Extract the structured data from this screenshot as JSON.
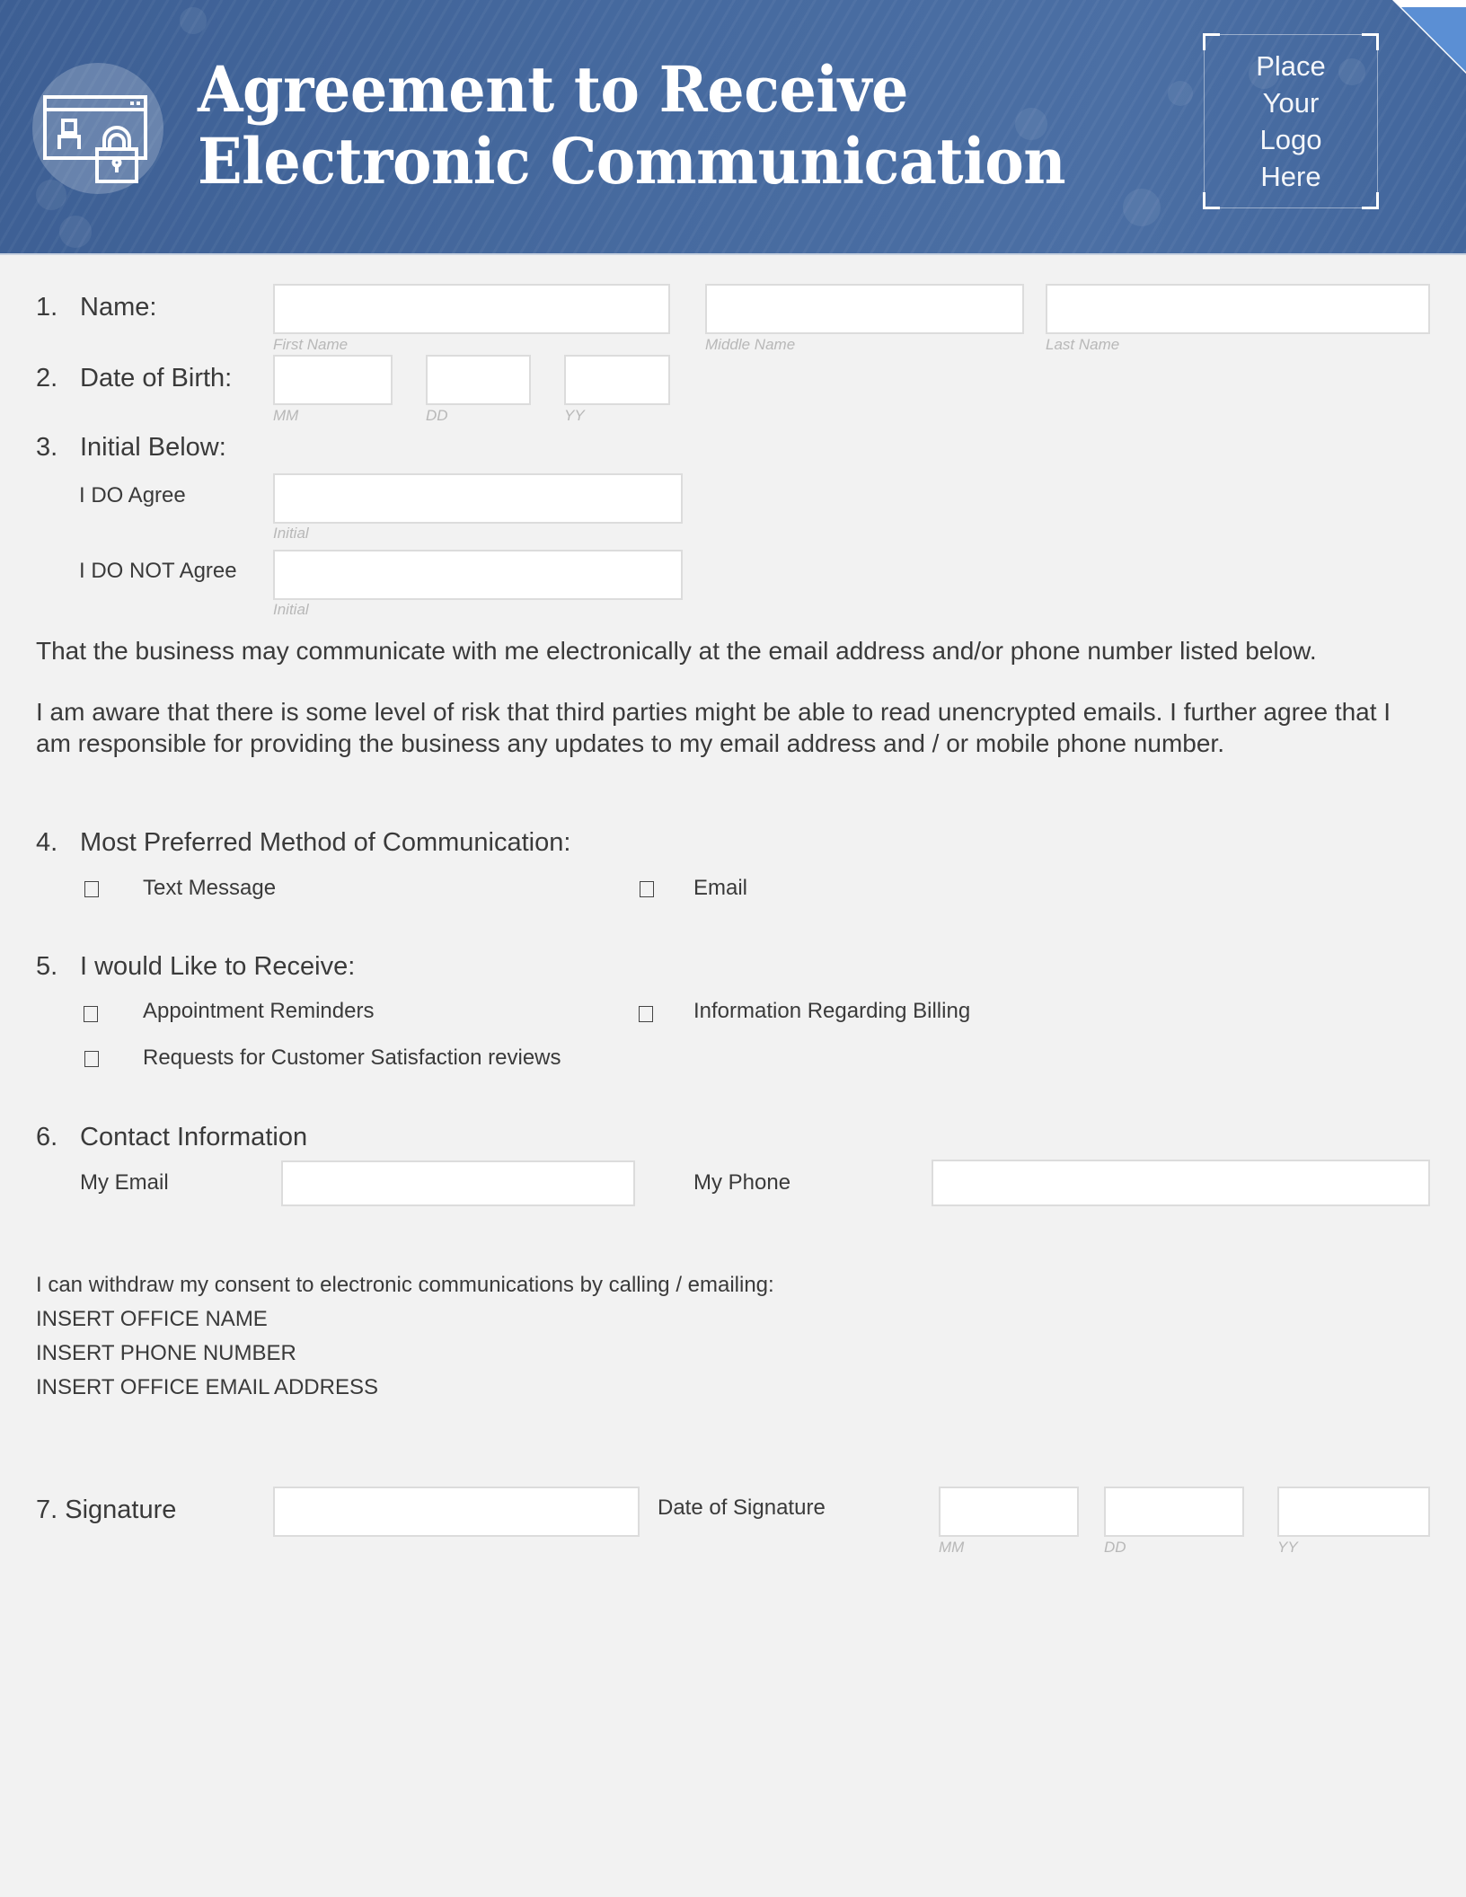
{
  "header": {
    "title_lines": [
      "Agreement to Receive",
      "Electronic Communication"
    ],
    "icon": "secure-browser-lock-icon",
    "logo_placeholder_lines": [
      "Place",
      "Your",
      "Logo",
      "Here"
    ],
    "colors": {
      "banner": "#466a9f",
      "corner_accent": "#5b8fd4",
      "text": "#ffffff"
    }
  },
  "form": {
    "name": {
      "number": "1.",
      "label": "Name:",
      "fields": [
        {
          "value": "",
          "hint": "First Name"
        },
        {
          "value": "",
          "hint": "Middle Name"
        },
        {
          "value": "",
          "hint": "Last Name"
        }
      ]
    },
    "dob": {
      "number": "2.",
      "label": "Date of Birth:",
      "fields": [
        {
          "value": "",
          "hint": "MM"
        },
        {
          "value": "",
          "hint": "DD"
        },
        {
          "value": "",
          "hint": "YY"
        }
      ]
    },
    "initials": {
      "number": "3.",
      "label": "Initial Below:",
      "agree": {
        "label": "I DO Agree",
        "value": "",
        "hint": "Initial"
      },
      "disagree": {
        "label": "I DO NOT Agree",
        "value": "",
        "hint": "Initial"
      }
    },
    "statement_1": "That the business may communicate with me electronically at the email address and/or phone number listed below.",
    "statement_2": "I am aware that there is some level of risk that third parties might be able to read unencrypted emails. I further agree that I am responsible for providing the business any updates to my email address and / or mobile phone number.",
    "preferred_method": {
      "number": "4.",
      "label": "Most Preferred Method of Communication:",
      "options": [
        {
          "label": "Text Message",
          "checked": false
        },
        {
          "label": "Email",
          "checked": false
        }
      ]
    },
    "receive": {
      "number": "5.",
      "label": "I would Like to Receive:",
      "options": [
        {
          "label": "Appointment Reminders",
          "checked": false
        },
        {
          "label": "Information Regarding Billing",
          "checked": false
        },
        {
          "label": "Requests for Customer Satisfaction reviews",
          "checked": false
        }
      ]
    },
    "contact": {
      "number": "6.",
      "label": "Contact Information",
      "email_label": "My Email",
      "email_value": "",
      "phone_label": "My Phone",
      "phone_value": ""
    },
    "withdraw": {
      "intro": "I can withdraw my consent to electronic communications by calling / emailing:",
      "office_name": "INSERT OFFICE NAME",
      "phone": "INSERT PHONE NUMBER",
      "email": "INSERT OFFICE EMAIL ADDRESS"
    },
    "signature": {
      "label": "7. Signature",
      "value": "",
      "date_label": "Date of Signature",
      "date_fields": [
        {
          "value": "",
          "hint": "MM"
        },
        {
          "value": "",
          "hint": "DD"
        },
        {
          "value": "",
          "hint": "YY"
        }
      ]
    }
  }
}
